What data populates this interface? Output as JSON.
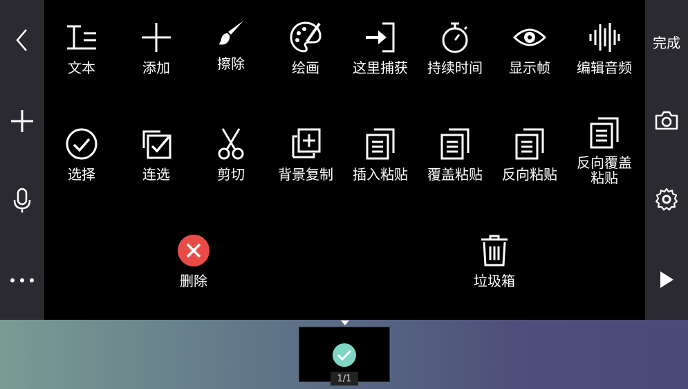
{
  "left_rail": {
    "items": [
      {
        "name": "back",
        "icon": "chevron-left-icon"
      },
      {
        "name": "add",
        "icon": "plus-icon"
      },
      {
        "name": "mic",
        "icon": "microphone-icon"
      },
      {
        "name": "more",
        "icon": "more-dots-icon"
      }
    ]
  },
  "right_rail": {
    "done_label": "完成",
    "items": [
      {
        "name": "camera",
        "icon": "camera-icon"
      },
      {
        "name": "settings",
        "icon": "gear-icon"
      },
      {
        "name": "play",
        "icon": "play-icon"
      }
    ]
  },
  "toolbar": {
    "row1": [
      {
        "label": "文本",
        "icon": "text-icon"
      },
      {
        "label": "添加",
        "icon": "plus-icon"
      },
      {
        "label": "擦除",
        "icon": "brush-icon"
      },
      {
        "label": "绘画",
        "icon": "palette-icon"
      },
      {
        "label": "这里捕获",
        "icon": "capture-icon"
      },
      {
        "label": "持续时间",
        "icon": "stopwatch-icon"
      },
      {
        "label": "显示帧",
        "icon": "eye-icon"
      },
      {
        "label": "编辑音频",
        "icon": "audio-wave-icon"
      }
    ],
    "row2": [
      {
        "label": "选择",
        "icon": "check-circle-icon"
      },
      {
        "label": "连选",
        "icon": "multi-select-icon"
      },
      {
        "label": "剪切",
        "icon": "scissors-icon"
      },
      {
        "label": "背景复制",
        "icon": "copy-plus-icon"
      },
      {
        "label": "插入粘贴",
        "icon": "paste-icon"
      },
      {
        "label": "覆盖粘贴",
        "icon": "paste-icon"
      },
      {
        "label": "反向粘贴",
        "icon": "paste-icon"
      },
      {
        "label_line1": "反向覆盖",
        "label_line2": "粘贴",
        "icon": "paste-icon"
      }
    ],
    "row3": [
      {
        "label": "删除",
        "icon": "delete-circle-icon"
      },
      {
        "label": "垃圾箱",
        "icon": "trash-icon"
      }
    ]
  },
  "timeline": {
    "counter": "1/1"
  },
  "colors": {
    "rail_bg": "#2a2a30",
    "delete_red": "#e94b47",
    "check_teal": "#7fd6c4"
  }
}
